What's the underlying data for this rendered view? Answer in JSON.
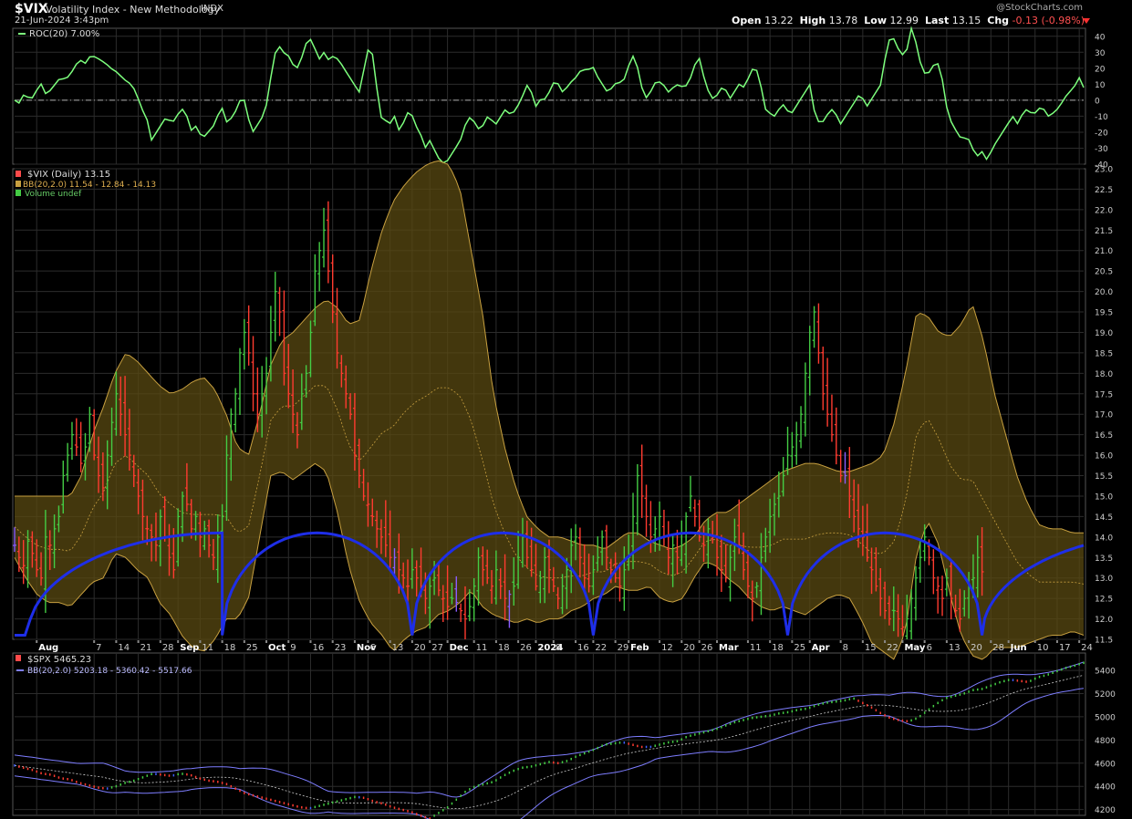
{
  "header": {
    "symbol": "$VIX",
    "name": "Volatility Index - New Methodology",
    "exchange": "INDX",
    "date": "21-Jun-2024 3:43pm",
    "credit": "@StockCharts.com",
    "open_label": "Open",
    "open": "13.22",
    "high_label": "High",
    "high": "13.78",
    "low_label": "Low",
    "low": "12.99",
    "last_label": "Last",
    "last": "13.15",
    "chg_label": "Chg",
    "chg": "-0.13 (-0.98%)"
  },
  "colors": {
    "up": "#44cc44",
    "down": "#ff3b30",
    "neutral": "#8a5cff",
    "roc": "#7dff7d",
    "band_fill": "#5a4a12",
    "band_line": "#c8a040",
    "cycle": "#1e2ee8",
    "spx_band": "#7d7dff"
  },
  "x_axis": {
    "labels": [
      {
        "t": "Aug",
        "bold": true,
        "i": 5
      },
      {
        "t": "7",
        "i": 18
      },
      {
        "t": "14",
        "i": 23
      },
      {
        "t": "21",
        "i": 28
      },
      {
        "t": "28",
        "i": 33
      },
      {
        "t": "Sep",
        "bold": true,
        "i": 37
      },
      {
        "t": "11",
        "i": 42
      },
      {
        "t": "18",
        "i": 47
      },
      {
        "t": "25",
        "i": 52
      },
      {
        "t": "Oct",
        "bold": true,
        "i": 57
      },
      {
        "t": "9",
        "i": 62
      },
      {
        "t": "16",
        "i": 67
      },
      {
        "t": "23",
        "i": 72
      },
      {
        "t": "Nov",
        "bold": true,
        "i": 77
      },
      {
        "t": "6",
        "i": 80
      },
      {
        "t": "13",
        "i": 85
      },
      {
        "t": "20",
        "i": 90
      },
      {
        "t": "27",
        "i": 94
      },
      {
        "t": "Dec",
        "bold": true,
        "i": 98
      },
      {
        "t": "11",
        "i": 104
      },
      {
        "t": "18",
        "i": 109
      },
      {
        "t": "26",
        "i": 114
      },
      {
        "t": "2024",
        "bold": true,
        "i": 118
      },
      {
        "t": "8",
        "i": 122
      },
      {
        "t": "16",
        "i": 127
      },
      {
        "t": "22",
        "i": 131
      },
      {
        "t": "29",
        "i": 136
      },
      {
        "t": "Feb",
        "bold": true,
        "i": 139
      },
      {
        "t": "12",
        "i": 146
      },
      {
        "t": "20",
        "i": 151
      },
      {
        "t": "26",
        "i": 155
      },
      {
        "t": "Mar",
        "bold": true,
        "i": 159
      },
      {
        "t": "11",
        "i": 166
      },
      {
        "t": "18",
        "i": 171
      },
      {
        "t": "25",
        "i": 176
      },
      {
        "t": "Apr",
        "bold": true,
        "i": 180
      },
      {
        "t": "8",
        "i": 187
      },
      {
        "t": "15",
        "i": 192
      },
      {
        "t": "22",
        "i": 197
      },
      {
        "t": "May",
        "bold": true,
        "i": 201
      },
      {
        "t": "6",
        "i": 206
      },
      {
        "t": "13",
        "i": 211
      },
      {
        "t": "20",
        "i": 216
      },
      {
        "t": "28",
        "i": 221
      },
      {
        "t": "Jun",
        "bold": true,
        "i": 225
      },
      {
        "t": "10",
        "i": 231
      },
      {
        "t": "17",
        "i": 236
      },
      {
        "t": "24",
        "i": 241
      }
    ]
  },
  "chart_data": [
    {
      "type": "line",
      "panel": "roc",
      "legend": "ROC(20) 7.00%",
      "ylim": [
        -40,
        45
      ],
      "yticks": [
        40,
        30,
        20,
        10,
        0,
        -10,
        -20,
        -30,
        -40
      ],
      "zero_line": true,
      "values": [
        0,
        -2,
        5,
        0,
        3,
        12,
        4,
        6,
        10,
        14,
        13,
        16,
        22,
        25,
        23,
        28,
        27,
        25,
        23,
        20,
        18,
        15,
        12,
        10,
        5,
        -5,
        -10,
        -25,
        -20,
        -15,
        -10,
        -15,
        -10,
        -5,
        -10,
        -20,
        -15,
        -25,
        -20,
        -18,
        -10,
        -5,
        -15,
        -10,
        -5,
        5,
        -10,
        -20,
        -15,
        -10,
        0,
        25,
        35,
        30,
        28,
        22,
        20,
        30,
        40,
        35,
        25,
        30,
        25,
        28,
        25,
        20,
        15,
        10,
        5,
        20,
        35,
        25,
        -10,
        -12,
        -15,
        -10,
        -20,
        -12,
        -5,
        -15,
        -20,
        -30,
        -25,
        -32,
        -38,
        -40,
        -35,
        -30,
        -25,
        -15,
        -10,
        -15,
        -20,
        -10,
        -12,
        -15,
        -10,
        -5,
        -10,
        -5,
        0,
        10,
        5,
        -5,
        2,
        0,
        10,
        12,
        5,
        8,
        12,
        15,
        20,
        18,
        22,
        15,
        10,
        5,
        8,
        12,
        10,
        20,
        28,
        20,
        5,
        0,
        10,
        12,
        10,
        5,
        8,
        10,
        8,
        10,
        20,
        28,
        15,
        5,
        0,
        5,
        10,
        0,
        5,
        10,
        8,
        15,
        22,
        15,
        -5,
        -8,
        -10,
        -5,
        -2,
        -10,
        -5,
        0,
        5,
        10,
        -10,
        -15,
        -12,
        -5,
        -8,
        -15,
        -10,
        -5,
        0,
        5,
        -5,
        0,
        5,
        10,
        30,
        42,
        35,
        28,
        30,
        45,
        35,
        20,
        15,
        20,
        25,
        15,
        -5,
        -15,
        -20,
        -25,
        -22,
        -30,
        -35,
        -32,
        -38,
        -30,
        -25,
        -20,
        -15,
        -10,
        -15,
        -8,
        -5,
        -10,
        -5,
        -5,
        -10,
        -8,
        -5,
        0,
        5,
        7,
        15,
        8
      ]
    },
    {
      "type": "bar",
      "panel": "vix",
      "legend": "$VIX (Daily) 13.15",
      "bb_legend": "BB(20,2.0) 11.54 - 12.84 - 14.13",
      "vol_legend": "Volume undef",
      "ylim": [
        11.5,
        23.0
      ],
      "yticks": [
        23.0,
        22.5,
        22.0,
        21.5,
        21.0,
        20.5,
        20.0,
        19.5,
        19.0,
        18.5,
        18.0,
        17.5,
        17.0,
        16.5,
        16.0,
        15.5,
        15.0,
        14.5,
        14.0,
        13.5,
        13.0,
        12.5,
        12.0,
        11.5
      ],
      "close": [
        13.8,
        13.5,
        13.3,
        13.9,
        13.6,
        13.2,
        13.0,
        14.0,
        13.8,
        14.2,
        14.5,
        15.5,
        16.0,
        16.5,
        16.2,
        15.8,
        16.2,
        17.0,
        16.0,
        15.5,
        15.2,
        16.0,
        16.8,
        17.5,
        17.0,
        16.5,
        16.0,
        15.5,
        15.0,
        14.5,
        14.2,
        14.0,
        13.8,
        14.5,
        14.0,
        13.5,
        13.2,
        14.5,
        15.0,
        14.8,
        14.2,
        14.5,
        14.0,
        14.2,
        13.8,
        13.5,
        14.0,
        14.5,
        16.0,
        17.0,
        17.5,
        18.5,
        19.0,
        18.5,
        17.5,
        17.0,
        17.5,
        18.0,
        19.0,
        20.0,
        19.5,
        18.0,
        17.5,
        17.0,
        16.5,
        17.5,
        18.0,
        19.0,
        20.5,
        21.0,
        21.5,
        20.5,
        19.5,
        18.5,
        18.0,
        17.5,
        17.0,
        16.0,
        15.5,
        15.0,
        14.8,
        14.5,
        14.2,
        14.0,
        13.8,
        13.5,
        13.5,
        13.2,
        13.0,
        12.8,
        13.2,
        13.0,
        12.8,
        12.5,
        12.8,
        13.0,
        12.7,
        12.5,
        12.3,
        12.5,
        12.4,
        12.2,
        12.0,
        12.3,
        12.8,
        13.5,
        13.2,
        13.0,
        12.8,
        13.2,
        12.8,
        12.5,
        12.6,
        12.8,
        13.5,
        14.0,
        13.5,
        13.2,
        12.8,
        13.0,
        13.5,
        13.2,
        12.8,
        12.5,
        12.8,
        13.2,
        13.8,
        14.0,
        13.5,
        13.0,
        12.8,
        13.2,
        13.5,
        14.0,
        13.5,
        13.2,
        13.0,
        12.8,
        13.2,
        13.5,
        14.5,
        15.5,
        15.0,
        14.5,
        14.0,
        14.2,
        14.5,
        14.0,
        13.5,
        13.8,
        13.5,
        13.8,
        14.5,
        15.0,
        14.5,
        14.0,
        13.8,
        14.2,
        14.0,
        13.5,
        13.2,
        13.0,
        13.5,
        14.0,
        13.8,
        13.2,
        12.8,
        12.5,
        12.8,
        13.5,
        14.0,
        14.5,
        14.8,
        15.0,
        15.5,
        16.0,
        16.2,
        16.5,
        17.0,
        18.0,
        19.0,
        19.5,
        18.5,
        17.5,
        17.0,
        16.5,
        16.0,
        15.5,
        15.5,
        15.0,
        14.5,
        14.2,
        14.0,
        13.5,
        13.2,
        12.8,
        12.5,
        12.2,
        12.0,
        12.2,
        12.0,
        11.8,
        12.0,
        12.5,
        13.0,
        13.5,
        14.0,
        13.5,
        13.0,
        12.8,
        12.5,
        13.0,
        12.5,
        12.2,
        12.0,
        12.5,
        12.8,
        13.0,
        13.5,
        13.15
      ],
      "bb_upper": [
        15.0,
        15.0,
        15.0,
        15.0,
        15.0,
        15.0,
        15.5,
        16.5,
        17.2,
        18.0,
        18.5,
        18.3,
        18.0,
        17.7,
        17.5,
        17.6,
        17.8,
        17.9,
        17.6,
        17.0,
        16.2,
        16.0,
        17.0,
        18.2,
        18.8,
        19.0,
        19.3,
        19.6,
        19.8,
        19.6,
        19.2,
        19.3,
        20.5,
        21.5,
        22.2,
        22.6,
        22.9,
        23.1,
        23.2,
        23.1,
        22.5,
        21.0,
        19.5,
        17.5,
        16.2,
        15.2,
        14.5,
        14.2,
        14.0,
        14.0,
        13.9,
        13.8,
        13.8,
        13.7,
        13.9,
        14.1,
        14.1,
        13.9,
        13.8,
        13.7,
        13.8,
        14.0,
        14.4,
        14.6,
        14.6,
        14.8,
        15.0,
        15.2,
        15.4,
        15.6,
        15.7,
        15.8,
        15.8,
        15.7,
        15.6,
        15.6,
        15.7,
        15.8,
        16.0,
        16.8,
        18.0,
        19.5,
        19.4,
        19.0,
        18.9,
        19.2,
        19.7,
        18.8,
        17.5,
        16.5,
        15.5,
        14.8,
        14.3,
        14.2,
        14.2,
        14.1,
        14.1
      ],
      "bb_lower": [
        13.5,
        13.0,
        12.6,
        12.4,
        12.4,
        12.3,
        12.6,
        12.9,
        13.0,
        13.6,
        13.5,
        13.2,
        13.0,
        12.4,
        12.1,
        11.6,
        11.3,
        11.2,
        11.5,
        12.0,
        12.0,
        12.5,
        14.0,
        15.5,
        15.6,
        15.4,
        15.6,
        15.8,
        15.6,
        14.6,
        13.3,
        12.4,
        11.9,
        11.6,
        11.2,
        11.5,
        11.7,
        11.8,
        12.1,
        12.2,
        12.4,
        12.7,
        12.3,
        12.1,
        12.0,
        11.9,
        12.0,
        11.9,
        12.0,
        12.0,
        12.2,
        12.3,
        12.5,
        12.6,
        12.8,
        12.7,
        12.7,
        12.8,
        12.5,
        12.4,
        12.5,
        13.0,
        13.4,
        13.3,
        13.0,
        12.8,
        12.5,
        12.3,
        12.2,
        12.3,
        12.2,
        12.1,
        12.3,
        12.5,
        12.6,
        12.5,
        12.0,
        11.4,
        11.2,
        11.0,
        11.7,
        13.6,
        14.4,
        13.8,
        12.6,
        11.6,
        11.1,
        11.0,
        11.3,
        11.3,
        11.3,
        11.4,
        11.5,
        11.6,
        11.6,
        11.7,
        11.6
      ],
      "cycle_lows": [
        47,
        90,
        131,
        175,
        219
      ],
      "cycle_top": 14.1,
      "cycle_bottom": 11.6
    },
    {
      "type": "bar",
      "panel": "spx",
      "legend": "$SPX 5465.23",
      "bb_legend": "BB(20,2.0) 5203.18 - 5360.42 - 5517.66",
      "ylim": [
        4150,
        5550
      ],
      "yticks": [
        5400,
        5200,
        5000,
        4800,
        4600,
        4400,
        4200
      ],
      "close": [
        4580,
        4560,
        4540,
        4510,
        4500,
        4470,
        4460,
        4430,
        4410,
        4390,
        4380,
        4400,
        4430,
        4450,
        4480,
        4510,
        4500,
        4490,
        4510,
        4500,
        4470,
        4450,
        4440,
        4420,
        4380,
        4340,
        4320,
        4300,
        4280,
        4260,
        4240,
        4220,
        4210,
        4230,
        4250,
        4270,
        4290,
        4310,
        4300,
        4270,
        4250,
        4220,
        4200,
        4180,
        4150,
        4120,
        4170,
        4220,
        4290,
        4360,
        4400,
        4420,
        4440,
        4490,
        4530,
        4560,
        4570,
        4590,
        4610,
        4600,
        4620,
        4660,
        4690,
        4720,
        4760,
        4770,
        4780,
        4760,
        4740,
        4740,
        4760,
        4780,
        4790,
        4830,
        4850,
        4870,
        4890,
        4920,
        4950,
        4970,
        4990,
        5000,
        5010,
        5030,
        5040,
        5060,
        5070,
        5100,
        5120,
        5130,
        5140,
        5160,
        5120,
        5080,
        5030,
        4990,
        4970,
        4960,
        4990,
        5050,
        5110,
        5160,
        5180,
        5200,
        5230,
        5240,
        5270,
        5300,
        5320,
        5310,
        5300,
        5340,
        5360,
        5390,
        5420,
        5440,
        5465
      ]
    }
  ]
}
